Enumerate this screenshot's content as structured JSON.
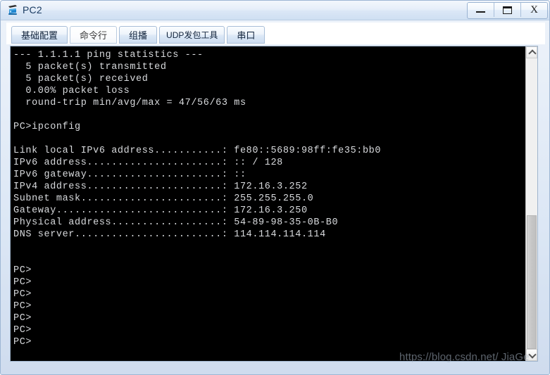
{
  "window": {
    "title": "PC2",
    "icon": "pc-device-icon",
    "controls": {
      "minimize": "minimize-button",
      "maximize": "maximize-button",
      "close": "X"
    }
  },
  "tabs": [
    {
      "label": "基础配置",
      "selected": false
    },
    {
      "label": "命令行",
      "selected": true
    },
    {
      "label": "组播",
      "selected": false
    },
    {
      "label": "UDP发包工具",
      "selected": false
    },
    {
      "label": "串口",
      "selected": false
    }
  ],
  "console": {
    "lines": [
      "--- 1.1.1.1 ping statistics ---",
      "  5 packet(s) transmitted",
      "  5 packet(s) received",
      "  0.00% packet loss",
      "  round-trip min/avg/max = 47/56/63 ms",
      "",
      "PC>ipconfig",
      "",
      "Link local IPv6 address...........: fe80::5689:98ff:fe35:bb0",
      "IPv6 address......................: :: / 128",
      "IPv6 gateway......................: ::",
      "IPv4 address......................: 172.16.3.252",
      "Subnet mask.......................: 255.255.255.0",
      "Gateway...........................: 172.16.3.250",
      "Physical address..................: 54-89-98-35-0B-B0",
      "DNS server........................: 114.114.114.114",
      "",
      "",
      "PC>",
      "PC>",
      "PC>",
      "PC>",
      "PC>",
      "PC>",
      "PC>"
    ],
    "ping_statistics": {
      "target": "1.1.1.1",
      "transmitted": 5,
      "received": 5,
      "packet_loss": "0.00%",
      "round_trip_min_ms": 47,
      "round_trip_avg_ms": 56,
      "round_trip_max_ms": 63
    },
    "ipconfig": {
      "link_local_ipv6_address": "fe80::5689:98ff:fe35:bb0",
      "ipv6_address": ":: / 128",
      "ipv6_gateway": "::",
      "ipv4_address": "172.16.3.252",
      "subnet_mask": "255.255.255.0",
      "gateway": "172.16.3.250",
      "physical_address": "54-89-98-35-0B-B0",
      "dns_server": "114.114.114.114"
    },
    "prompt": "PC>"
  },
  "scrollbar": {
    "up_arrow": "scroll-up-icon",
    "down_arrow": "scroll-down-icon"
  },
  "watermark": "https://blog.csdn.net/ JiaGe"
}
